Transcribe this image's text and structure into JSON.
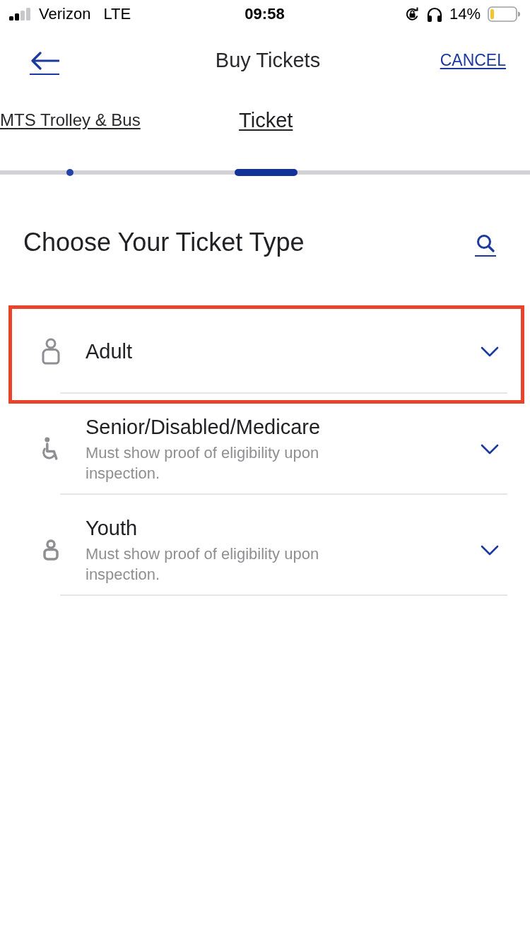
{
  "status_bar": {
    "carrier": "Verizon",
    "network": "LTE",
    "time": "09:58",
    "battery_percent": "14%"
  },
  "nav": {
    "title": "Buy Tickets",
    "cancel": "CANCEL"
  },
  "steps": [
    {
      "label": "MTS Trolley & Bus",
      "selected": false
    },
    {
      "label": "Ticket",
      "selected": true
    }
  ],
  "heading": "Choose Your Ticket Type",
  "ticket_types": [
    {
      "kind": "person",
      "title": "Adult",
      "expanded": false,
      "highlighted": true
    },
    {
      "kind": "wheelchair",
      "title": "Senior/Disabled/Medicare",
      "note": "Must show proof of eligibility upon inspection.",
      "expanded": false,
      "highlighted": false
    },
    {
      "kind": "small-person",
      "title": "Youth",
      "note": "Must show proof of eligibility upon inspection.",
      "expanded": false,
      "highlighted": false
    }
  ]
}
